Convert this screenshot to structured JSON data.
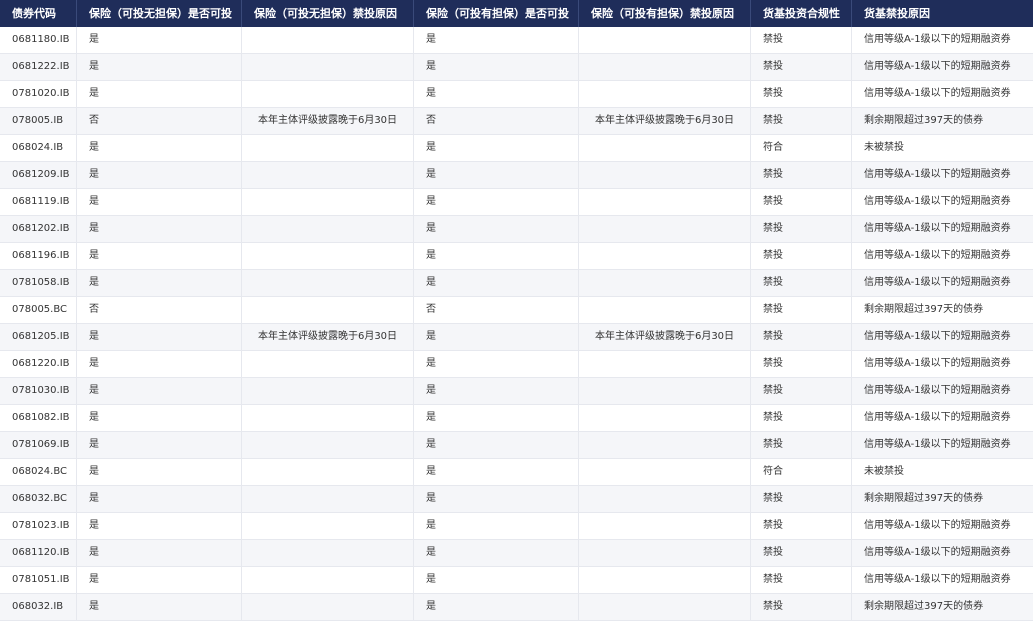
{
  "table": {
    "headers": [
      "债券代码",
      "保险（可投无担保）是否可投",
      "保险（可投无担保）禁投原因",
      "保险（可投有担保）是否可投",
      "保险（可投有担保）禁投原因",
      "货基投资合规性",
      "货基禁投原因"
    ],
    "rows": [
      [
        "0681180.IB",
        "是",
        "",
        "是",
        "",
        "禁投",
        "信用等级A-1级以下的短期融资券"
      ],
      [
        "0681222.IB",
        "是",
        "",
        "是",
        "",
        "禁投",
        "信用等级A-1级以下的短期融资券"
      ],
      [
        "0781020.IB",
        "是",
        "",
        "是",
        "",
        "禁投",
        "信用等级A-1级以下的短期融资券"
      ],
      [
        "078005.IB",
        "否",
        "本年主体评级披露晚于6月30日",
        "否",
        "本年主体评级披露晚于6月30日",
        "禁投",
        "剩余期限超过397天的债券"
      ],
      [
        "068024.IB",
        "是",
        "",
        "是",
        "",
        "符合",
        "未被禁投"
      ],
      [
        "0681209.IB",
        "是",
        "",
        "是",
        "",
        "禁投",
        "信用等级A-1级以下的短期融资券"
      ],
      [
        "0681119.IB",
        "是",
        "",
        "是",
        "",
        "禁投",
        "信用等级A-1级以下的短期融资券"
      ],
      [
        "0681202.IB",
        "是",
        "",
        "是",
        "",
        "禁投",
        "信用等级A-1级以下的短期融资券"
      ],
      [
        "0681196.IB",
        "是",
        "",
        "是",
        "",
        "禁投",
        "信用等级A-1级以下的短期融资券"
      ],
      [
        "0781058.IB",
        "是",
        "",
        "是",
        "",
        "禁投",
        "信用等级A-1级以下的短期融资券"
      ],
      [
        "078005.BC",
        "否",
        "",
        "否",
        "",
        "禁投",
        "剩余期限超过397天的债券"
      ],
      [
        "0681205.IB",
        "是",
        "本年主体评级披露晚于6月30日",
        "是",
        "本年主体评级披露晚于6月30日",
        "禁投",
        "信用等级A-1级以下的短期融资券"
      ],
      [
        "0681220.IB",
        "是",
        "",
        "是",
        "",
        "禁投",
        "信用等级A-1级以下的短期融资券"
      ],
      [
        "0781030.IB",
        "是",
        "",
        "是",
        "",
        "禁投",
        "信用等级A-1级以下的短期融资券"
      ],
      [
        "0681082.IB",
        "是",
        "",
        "是",
        "",
        "禁投",
        "信用等级A-1级以下的短期融资券"
      ],
      [
        "0781069.IB",
        "是",
        "",
        "是",
        "",
        "禁投",
        "信用等级A-1级以下的短期融资券"
      ],
      [
        "068024.BC",
        "是",
        "",
        "是",
        "",
        "符合",
        "未被禁投"
      ],
      [
        "068032.BC",
        "是",
        "",
        "是",
        "",
        "禁投",
        "剩余期限超过397天的债券"
      ],
      [
        "0781023.IB",
        "是",
        "",
        "是",
        "",
        "禁投",
        "信用等级A-1级以下的短期融资券"
      ],
      [
        "0681120.IB",
        "是",
        "",
        "是",
        "",
        "禁投",
        "信用等级A-1级以下的短期融资券"
      ],
      [
        "0781051.IB",
        "是",
        "",
        "是",
        "",
        "禁投",
        "信用等级A-1级以下的短期融资券"
      ],
      [
        "068032.IB",
        "是",
        "",
        "是",
        "",
        "禁投",
        "剩余期限超过397天的债券"
      ]
    ]
  }
}
